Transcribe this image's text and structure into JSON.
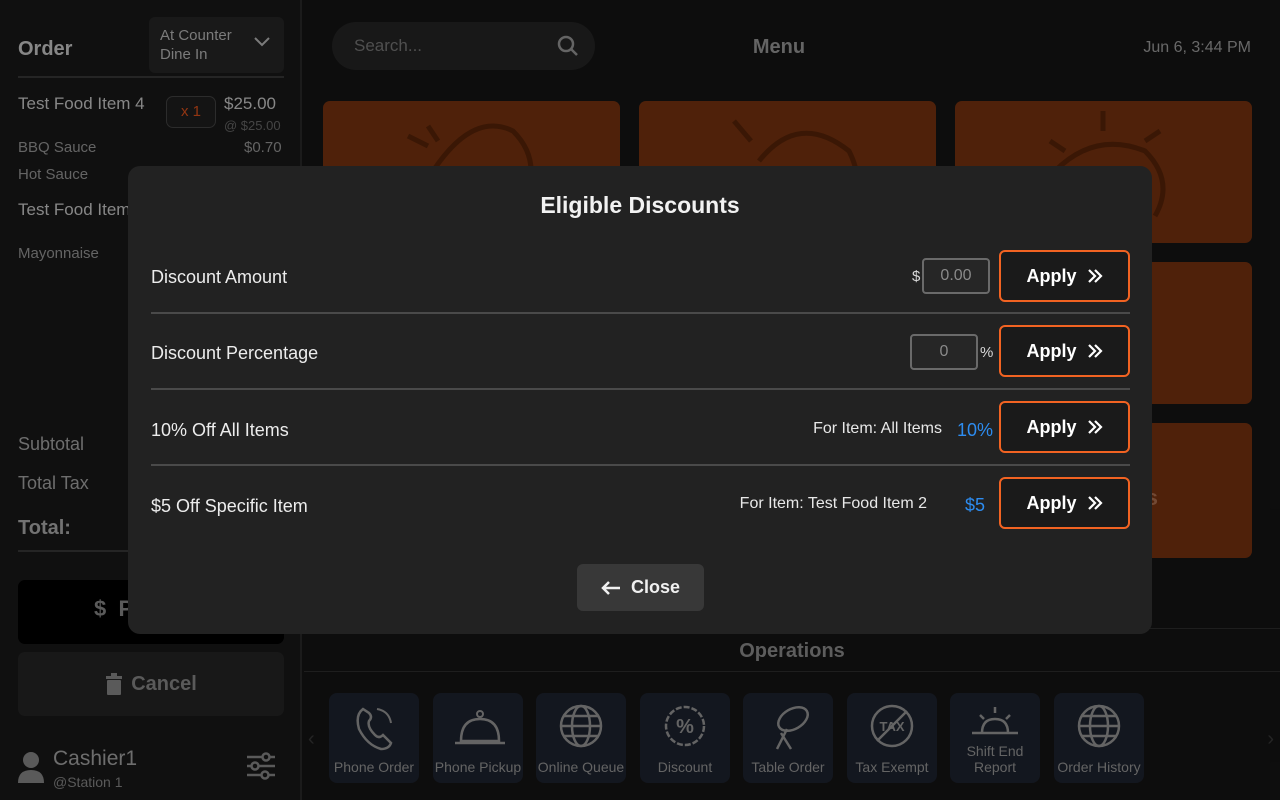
{
  "order": {
    "title": "Order",
    "type_line1": "At Counter",
    "type_line2": "Dine In",
    "items": [
      {
        "name": "Test Food Item 4",
        "qty": "x 1",
        "price": "$25.00",
        "unit": "@ $25.00",
        "mods": [
          {
            "name": "BBQ Sauce",
            "price": "$0.70"
          },
          {
            "name": "Hot Sauce",
            "price": ""
          }
        ]
      },
      {
        "name": "Test Food Item",
        "mods": [
          {
            "name": "Mayonnaise"
          }
        ]
      }
    ],
    "subtotal_label": "Subtotal",
    "tax_label": "Total Tax",
    "total_label": "Total:",
    "pay_label": "P",
    "cancel_label": "Cancel"
  },
  "cashier": {
    "name": "Cashier1",
    "station": "@Station 1"
  },
  "topbar": {
    "search_placeholder": "Search...",
    "menu_title": "Menu",
    "datetime": "Jun 6, 3:44 PM"
  },
  "menu_tiles": [
    {
      "label": "",
      "icon": "food-icon"
    },
    {
      "label": "",
      "icon": "food-icon"
    },
    {
      "label": "",
      "icon": "food-icon"
    },
    {
      "label": "ras",
      "icon": "food-icon"
    }
  ],
  "operations": {
    "title": "Operations",
    "items": [
      {
        "label": "Phone Order",
        "icon": "phone-icon"
      },
      {
        "label": "Phone Pickup",
        "icon": "bell-icon"
      },
      {
        "label": "Online Queue",
        "icon": "globe-icon"
      },
      {
        "label": "Discount",
        "icon": "discount-icon"
      },
      {
        "label": "Table Order",
        "icon": "table-icon"
      },
      {
        "label": "Tax Exempt",
        "icon": "tax-exempt-icon"
      },
      {
        "label": "Shift End Report",
        "icon": "sunset-icon"
      },
      {
        "label": "Order History",
        "icon": "globe-icon"
      }
    ]
  },
  "modal": {
    "title": "Eligible Discounts",
    "apply_label": "Apply",
    "close_label": "Close",
    "rows": [
      {
        "label": "Discount Amount",
        "prefix": "$",
        "placeholder": "0.00"
      },
      {
        "label": "Discount Percentage",
        "suffix": "%",
        "placeholder": "0"
      },
      {
        "label": "10% Off All Items",
        "for_item": "For Item: All Items",
        "value": "10%"
      },
      {
        "label": "$5 Off Specific Item",
        "for_item": "For Item: Test Food Item 2",
        "value": "$5"
      }
    ]
  },
  "colors": {
    "accent": "#f26322",
    "discount_value": "#2d8cf0",
    "tile": "#7a3410",
    "ops_tile": "#1e2430"
  }
}
